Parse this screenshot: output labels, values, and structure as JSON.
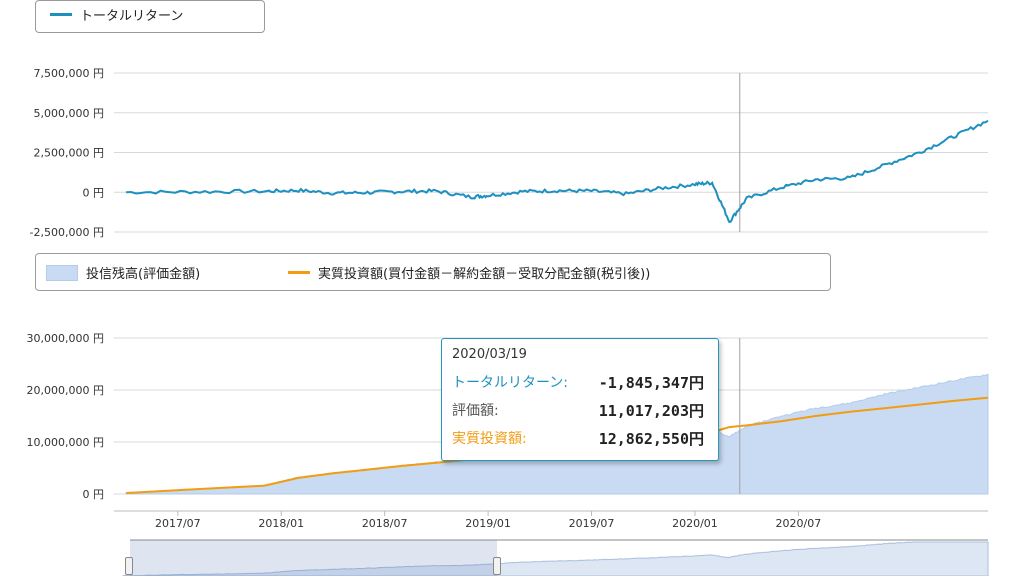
{
  "colors": {
    "total_return": "#1e90c0",
    "balance_fill": "#c9dbf2",
    "balance_line": "#b4cbea",
    "investment": "#f39c12",
    "grid": "#d8d8d8",
    "crosshair": "#a0a0a0"
  },
  "legend_top": {
    "series": "トータルリターン"
  },
  "legend_bottom": {
    "area": "投信残高(評価金額)",
    "line": "実質投資額(買付金額－解約金額－受取分配金額(税引後))"
  },
  "tooltip": {
    "date": "2020/03/19",
    "rows": [
      {
        "label": "トータルリターン:",
        "value": "-1,845,347円",
        "color": "#1e90c0"
      },
      {
        "label": "評価額:",
        "value": "11,017,203円",
        "color": "#555555"
      },
      {
        "label": "実質投資額:",
        "value": "12,862,550円",
        "color": "#f39c12"
      }
    ]
  },
  "chart_data": [
    {
      "type": "line",
      "series": [
        {
          "name": "トータルリターン",
          "x": [
            "2017-04",
            "2017-08",
            "2017-12",
            "2018-02",
            "2018-04",
            "2018-06",
            "2018-08",
            "2018-10",
            "2018-12",
            "2019-01",
            "2019-03",
            "2019-05",
            "2019-07",
            "2019-09",
            "2019-11",
            "2020-01",
            "2020-02",
            "2020-03",
            "2020-04",
            "2020-06",
            "2020-08",
            "2020-10",
            "2020-12",
            "2021-02",
            "2021-04",
            "2021-06"
          ],
          "y": [
            0,
            30000,
            60000,
            120000,
            -50000,
            -20000,
            50000,
            80000,
            -300000,
            -200000,
            50000,
            100000,
            80000,
            -100000,
            250000,
            500000,
            600000,
            -1845347,
            -400000,
            300000,
            800000,
            900000,
            1700000,
            2500000,
            3500000,
            4500000
          ]
        }
      ],
      "y_ticks": [
        "7,500,000 円",
        "5,000,000 円",
        "2,500,000 円",
        "0 円",
        "-2,500,000 円"
      ],
      "ylim": [
        -2500000,
        7500000
      ],
      "crosshair_x": "2020-03-19"
    },
    {
      "type": "area",
      "series": [
        {
          "name": "投信残高(評価金額)",
          "x": [
            "2017-04",
            "2017-08",
            "2017-12",
            "2018-02",
            "2018-04",
            "2018-06",
            "2018-08",
            "2018-10",
            "2018-12",
            "2019-01",
            "2019-03",
            "2019-05",
            "2019-07",
            "2019-09",
            "2019-11",
            "2020-01",
            "2020-02",
            "2020-03",
            "2020-04",
            "2020-06",
            "2020-08",
            "2020-10",
            "2020-12",
            "2021-02",
            "2021-04",
            "2021-06"
          ],
          "y": [
            200000,
            900000,
            1600000,
            3200000,
            3900000,
            4600000,
            5400000,
            6100000,
            6400000,
            7000000,
            8200000,
            8900000,
            9500000,
            10200000,
            11000000,
            12000000,
            12500000,
            11017203,
            13000000,
            15000000,
            16500000,
            17500000,
            19200000,
            20500000,
            21800000,
            23000000
          ]
        },
        {
          "name": "実質投資額(買付金額－解約金額－受取分配金額(税引後))",
          "x": [
            "2017-04",
            "2017-08",
            "2017-12",
            "2018-02",
            "2018-04",
            "2018-06",
            "2018-08",
            "2018-10",
            "2018-12",
            "2019-01",
            "2019-03",
            "2019-05",
            "2019-07",
            "2019-09",
            "2019-11",
            "2020-01",
            "2020-02",
            "2020-03",
            "2020-04",
            "2020-06",
            "2020-08",
            "2020-10",
            "2020-12",
            "2021-02",
            "2021-04",
            "2021-06"
          ],
          "y": [
            200000,
            900000,
            1600000,
            3100000,
            4000000,
            4700000,
            5400000,
            6000000,
            6700000,
            7200000,
            8200000,
            8800000,
            9400000,
            10300000,
            10800000,
            11500000,
            11900000,
            12862550,
            13200000,
            14000000,
            15000000,
            15800000,
            16500000,
            17200000,
            17900000,
            18500000
          ]
        }
      ],
      "y_ticks": [
        "30,000,000 円",
        "20,000,000 円",
        "10,000,000 円",
        "0 円"
      ],
      "ylim": [
        0,
        30000000
      ],
      "x_ticks": [
        "2017/07",
        "2018/01",
        "2018/07",
        "2019/01",
        "2019/07",
        "2020/01",
        "2020/07"
      ],
      "crosshair_x": "2020-03-19"
    }
  ]
}
